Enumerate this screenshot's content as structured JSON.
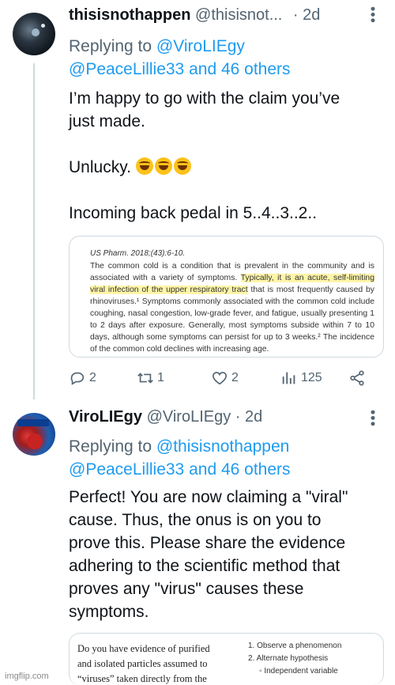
{
  "tweet1": {
    "display_name": "thisisnothappen",
    "handle": "@thisisnot...",
    "separator": "·",
    "time": "2d",
    "more_icon": "more-icon",
    "replying_prefix": "Replying to ",
    "replying_to": "@ViroLIEgy",
    "replying_line2_user": "@PeaceLillie33",
    "replying_line2_rest": " and 46 others",
    "text_line1": "I’m happy to go with the claim you’ve",
    "text_line2": "just made.",
    "text_line3": "Unlucky. ",
    "emoji": [
      "grinning-squinting-face",
      "grinning-squinting-face",
      "grinning-squinting-face"
    ],
    "text_line4": "Incoming back pedal in 5..4..3..2..",
    "card": {
      "ref": "US Pharm. 2018;(43):6-10.",
      "body_before": "The common cold is a condition that is prevalent in the community and is associated with a variety of symptoms. ",
      "body_highlight": "Typically, it is an acute, self-limiting viral infection of the upper respiratory tract",
      "body_after": " that is most frequently caused by rhinoviruses.¹ Symptoms commonly associated with the common cold include coughing, nasal congestion, low-grade fever, and fatigue, usually presenting 1 to 2 days after exposure. Generally, most symptoms subside within 7 to 10 days, although some symptoms can persist for up to 3 weeks.² The incidence of the common cold declines with increasing age."
    },
    "actions": {
      "replies": "2",
      "retweets": "1",
      "likes": "2",
      "views": "125"
    }
  },
  "tweet2": {
    "display_name": "ViroLIEgy",
    "handle": "@ViroLIEgy",
    "separator": "·",
    "time": "2d",
    "replying_prefix": "Replying to ",
    "replying_to": "@thisisnothappen",
    "replying_line2_user": "@PeaceLillie33",
    "replying_line2_rest": " and 46 others",
    "text_lines": [
      "Perfect! You are now claiming a \"viral\"",
      "cause. Thus, the onus is on you to",
      "prove this. Please share the evidence",
      "adhering to the scientific method that",
      "proves any \"virus\" causes these",
      "symptoms."
    ],
    "image_left_lines": [
      "Do you have evidence of purified",
      "and isolated particles assumed to",
      "“viruses” taken directly from the"
    ],
    "image_right_lines": [
      "1. Observe a phenomenon",
      "2. Alternate hypothesis",
      "◦ Independent variable"
    ]
  },
  "watermark": "imgflip.com",
  "colors": {
    "accent": "#1d9bf0",
    "muted": "#536471",
    "line": "#cfd9de"
  }
}
